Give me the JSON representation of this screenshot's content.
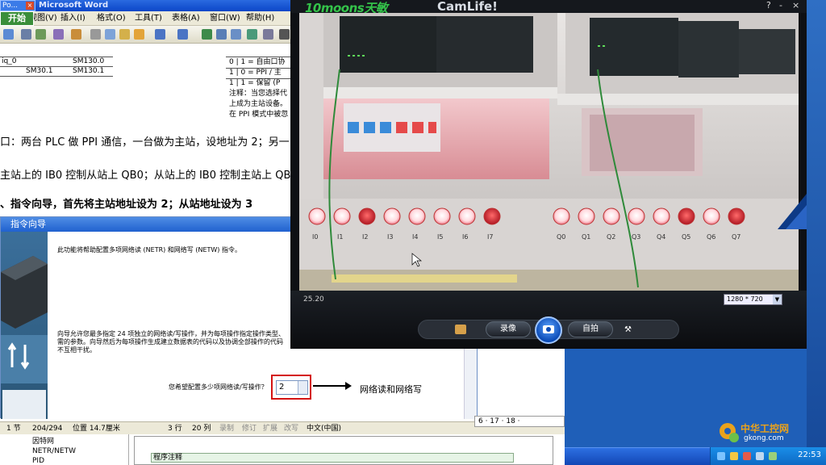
{
  "word": {
    "title": "Microsoft Word",
    "taskbar_mini_label": "Po...",
    "start_label": "开始",
    "menu": [
      "视图(V)",
      "插入(I)",
      "格式(O)",
      "工具(T)",
      "表格(A)",
      "窗口(W)",
      "帮助(H)"
    ],
    "table": {
      "rows": [
        [
          "iq_0",
          "SM130.0"
        ],
        [
          "SM30.1",
          "SM130.1"
        ]
      ],
      "right_rows": [
        "0 | 1 = 自由口协",
        "1 | 0 = PPI / 主",
        "1 | 1 = 保留 (P"
      ],
      "note_lines": [
        "注释：当您选择代",
        "上成为主站设备。",
        "在 PPI 模式中被忽"
      ]
    },
    "paragraphs": [
      "口：两台 PLC 做 PPI 通信，一台做为主站，设地址为 2；另一台",
      "主站上的 IB0 控制从站上 QB0；从站上的 IB0 控制主站上 QB0",
      "、指令向导，首先将主站地址设为 2；从站地址设为 3"
    ],
    "status": {
      "section": "1 节",
      "page": "204/294",
      "position": "位置 14.7厘米",
      "line": "3 行",
      "col": "20 列",
      "rec": "录制",
      "trk": "修订",
      "ext": "扩展",
      "ovr": "改写",
      "lang": "中文(中国)"
    },
    "ruler": "6 · 17 · 18 ·"
  },
  "wizard": {
    "title": "指令向导",
    "intro": "此功能将帮助配置多项网络读 (NETR) 和网络写 (NETW) 指令。",
    "desc_1": "向导允许您最多指定 24 项独立的网络读/写操作，并为每项操作指定操作类型、",
    "desc_2": "需的参数。向导然后为每项操作生成建立数据表的代码以及协调全部操作的代码",
    "desc_3": "不互相干扰。",
    "question": "您希望配置多少项网络读/写操作？",
    "spin_value": "2",
    "annotation": "网络读和网络写"
  },
  "tree": {
    "items": [
      "因特网",
      "NETR/NETW",
      "PID"
    ]
  },
  "program": {
    "label": "程序注释"
  },
  "camera": {
    "brand": "10moons天敏",
    "app": "CamLife!",
    "controls": [
      "?",
      "-",
      "×"
    ],
    "timecode": "25.20",
    "resolution": "1280 * 720",
    "record_label": "录像",
    "selfie_label": "自拍",
    "lamp_labels_left": [
      "I0",
      "I1",
      "I2",
      "I3",
      "I4",
      "I5",
      "I6",
      "I7"
    ],
    "lamp_labels_right": [
      "Q0",
      "Q1",
      "Q2",
      "Q3",
      "Q4",
      "Q5",
      "Q6",
      "Q7"
    ]
  },
  "taskbar": {
    "clock": "22:53"
  },
  "watermark": {
    "name": "中华工控网",
    "url": "gkong.com"
  },
  "colors": {
    "xp_blue": "#1f5fb8",
    "cam_green": "#34c34a",
    "highlight_red": "#d41313",
    "lamp_red": "#e62e2e",
    "lamp_on": "#ffd9de"
  }
}
